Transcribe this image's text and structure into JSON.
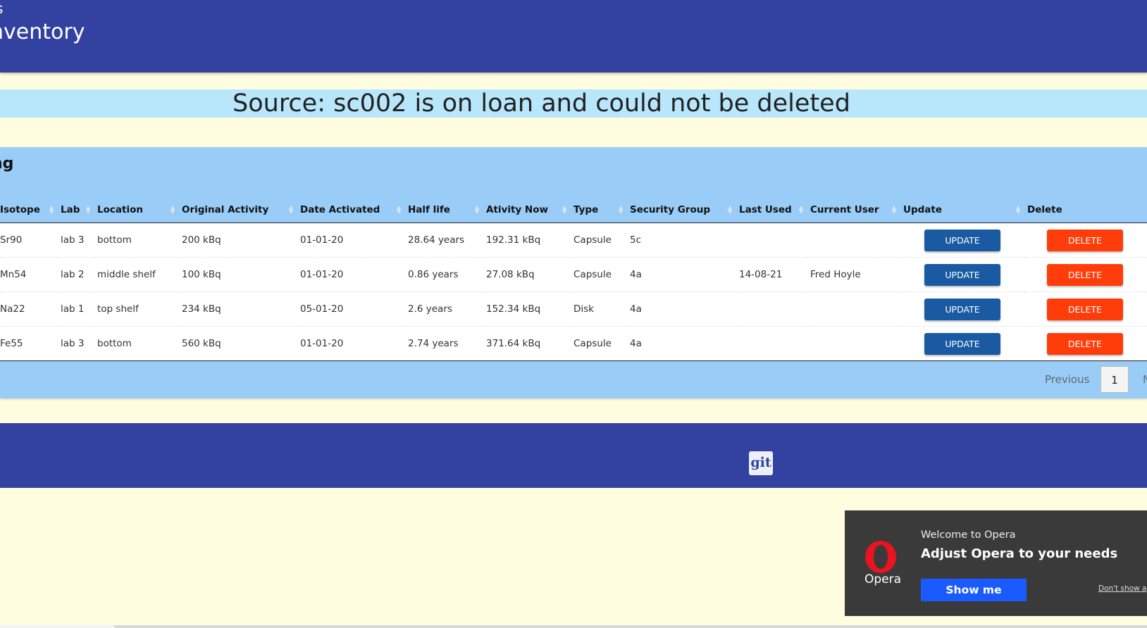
{
  "header": {
    "brand_top": "s",
    "title": "nventory"
  },
  "flash": {
    "message": "Source: sc002 is on loan and could not be deleted"
  },
  "panel": {
    "title": "ng"
  },
  "table": {
    "columns": [
      "Isotope",
      "Lab",
      "Location",
      "Original Activity",
      "Date Activated",
      "Half life",
      "Ativity Now",
      "Type",
      "Security Group",
      "Last Used",
      "Current User",
      "Update",
      "Delete"
    ],
    "rows": [
      {
        "isotope": "Sr90",
        "lab": "lab 3",
        "location": "bottom",
        "original_activity": "200 kBq",
        "date_activated": "01-01-20",
        "half_life": "28.64 years",
        "activity_now": "192.31 kBq",
        "type": "Capsule",
        "security_group": "5c",
        "last_used": "",
        "current_user": "",
        "update_label": "UPDATE",
        "delete_label": "DELETE"
      },
      {
        "isotope": "Mn54",
        "lab": "lab 2",
        "location": "middle shelf",
        "original_activity": "100 kBq",
        "date_activated": "01-01-20",
        "half_life": "0.86 years",
        "activity_now": "27.08 kBq",
        "type": "Capsule",
        "security_group": "4a",
        "last_used": "14-08-21",
        "current_user": "Fred Hoyle",
        "update_label": "UPDATE",
        "delete_label": "DELETE"
      },
      {
        "isotope": "Na22",
        "lab": "lab 1",
        "location": "top shelf",
        "original_activity": "234 kBq",
        "date_activated": "05-01-20",
        "half_life": "2.6 years",
        "activity_now": "152.34 kBq",
        "type": "Disk",
        "security_group": "4a",
        "last_used": "",
        "current_user": "",
        "update_label": "UPDATE",
        "delete_label": "DELETE"
      },
      {
        "isotope": "Fe55",
        "lab": "lab 3",
        "location": "bottom",
        "original_activity": "560 kBq",
        "date_activated": "01-01-20",
        "half_life": "2.74 years",
        "activity_now": "371.64 kBq",
        "type": "Capsule",
        "security_group": "4a",
        "last_used": "",
        "current_user": "",
        "update_label": "UPDATE",
        "delete_label": "DELETE"
      }
    ]
  },
  "pagination": {
    "previous": "Previous",
    "current_page": "1",
    "next": "N"
  },
  "footer": {
    "git_label": "git"
  },
  "opera_popup": {
    "logo_text": "Opera",
    "kicker": "Welcome to Opera",
    "title": "Adjust Opera to your needs",
    "button": "Show me",
    "dismiss": "Don't show ag"
  },
  "colors": {
    "header_bg": "#3341a0",
    "page_bg": "#fffde0",
    "flash_bg": "#b8e6fb",
    "panel_bg": "#99cdf8",
    "update_btn": "#1a5aa3",
    "delete_btn": "#ff3d0a",
    "opera_red": "#e8141f",
    "opera_btn": "#1a5bff"
  }
}
